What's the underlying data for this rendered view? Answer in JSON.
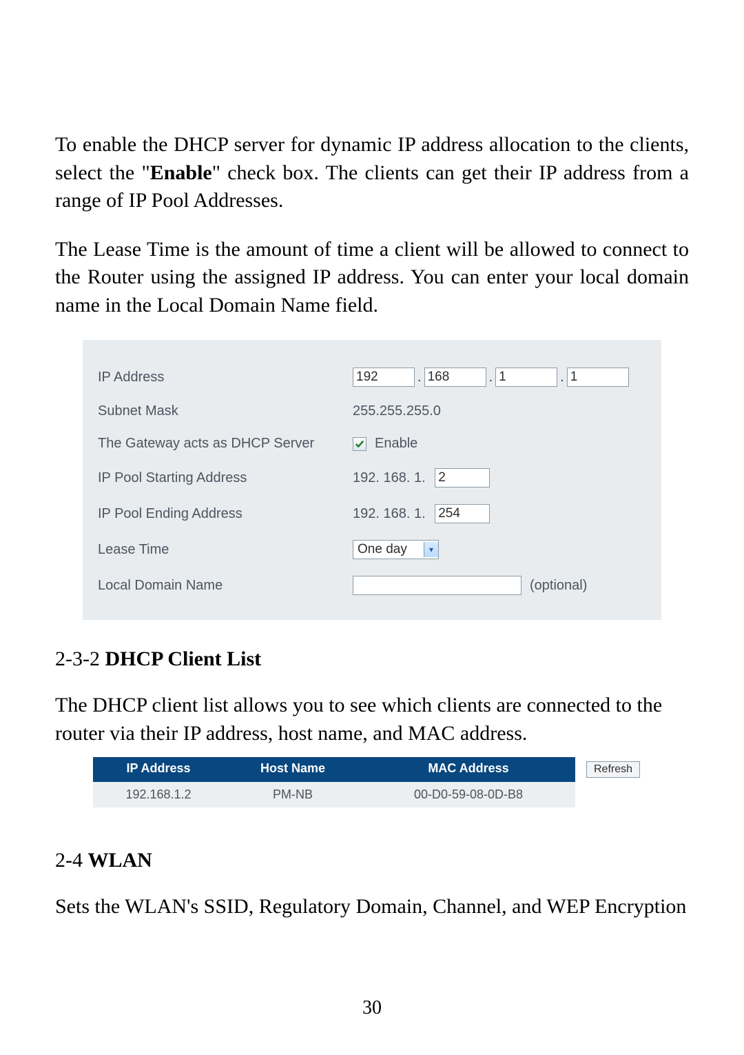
{
  "intro": {
    "p1_a": "To enable the DHCP server for dynamic IP address allocation to the clients, select the \"",
    "p1_bold": "Enable",
    "p1_b": "\" check box. The clients can get their IP address from a range of IP Pool Addresses.",
    "p2": "The Lease Time is the amount of time a client will be allowed to connect to the Router using the assigned IP address. You can enter your local domain name in the Local Domain Name field."
  },
  "settings": {
    "ip_label": "IP Address",
    "ip": {
      "o1": "192",
      "o2": "168",
      "o3": "1",
      "o4": "1"
    },
    "subnet_label": "Subnet Mask",
    "subnet_value": "255.255.255.0",
    "dhcp_label": "The Gateway acts as DHCP Server",
    "dhcp_enable_text": "Enable",
    "pool_start_label": "IP Pool Starting Address",
    "pool_start_prefix": "192. 168. 1.",
    "pool_start_value": "2",
    "pool_end_label": "IP Pool Ending Address",
    "pool_end_prefix": "192. 168. 1.",
    "pool_end_value": "254",
    "lease_label": "Lease Time",
    "lease_value": "One day",
    "domain_label": "Local Domain Name",
    "domain_value": "",
    "optional_text": "(optional)"
  },
  "sections": {
    "s232_num": "2-3-2 ",
    "s232_title": "DHCP Client List",
    "s232_text": "The DHCP client list allows you to see which clients are connected to the router via their IP address, host name, and MAC address.",
    "s24_num": "2-4 ",
    "s24_title": "WLAN",
    "s24_text": "Sets the WLAN's SSID, Regulatory Domain, Channel, and WEP Encryption"
  },
  "client_table": {
    "headers": {
      "ip": "IP Address",
      "host": "Host Name",
      "mac": "MAC Address"
    },
    "refresh": "Refresh",
    "rows": [
      {
        "ip": "192.168.1.2",
        "host": "PM-NB",
        "mac": "00-D0-59-08-0D-B8"
      }
    ]
  },
  "page_number": "30"
}
